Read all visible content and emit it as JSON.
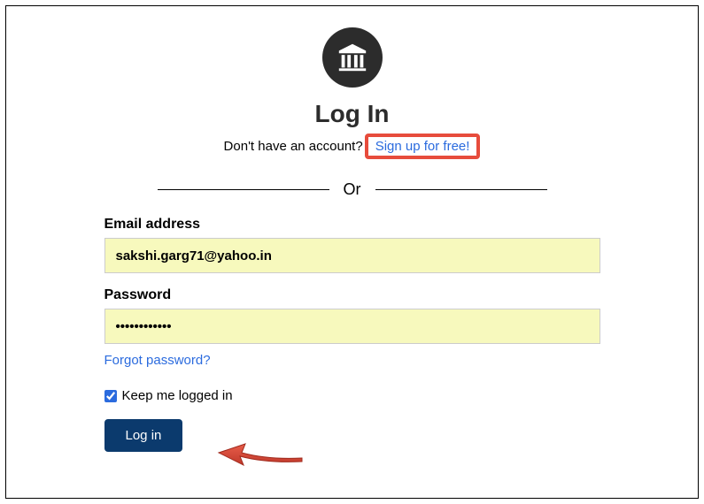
{
  "header": {
    "title": "Log In",
    "subtitle_text": "Don't have an account?",
    "signup_link_text": "Sign up for free!",
    "or_text": "Or"
  },
  "form": {
    "email_label": "Email address",
    "email_value": "sakshi.garg71@yahoo.in",
    "password_label": "Password",
    "password_value": "••••••••••••",
    "forgot_password_text": "Forgot password?",
    "keep_logged_in_label": "Keep me logged in",
    "keep_logged_in_checked": true,
    "login_button_label": "Log in"
  },
  "icons": {
    "logo": "archive-building-icon"
  },
  "annotations": {
    "highlight_signup": true,
    "arrow_to_login": true
  }
}
